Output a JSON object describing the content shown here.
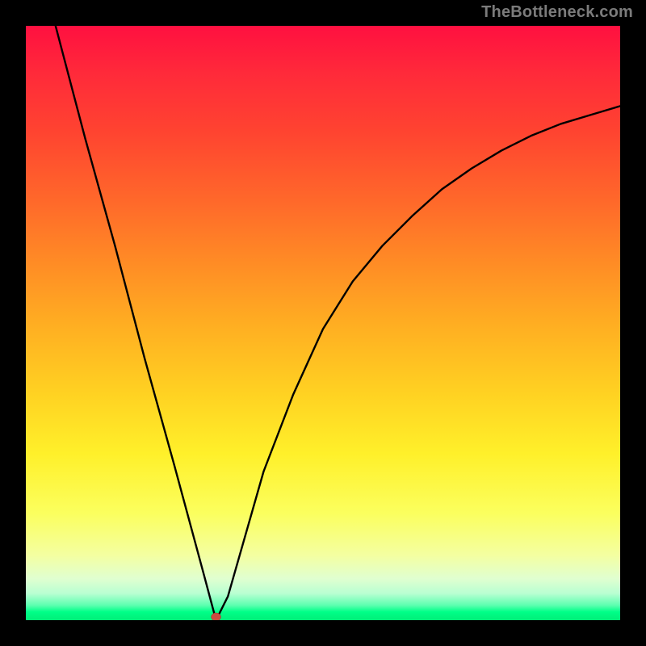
{
  "watermark": "TheBottleneck.com",
  "colors": {
    "background": "#000000",
    "curve": "#000000",
    "dot": "#cc4a3f",
    "gradient_top": "#ff1040",
    "gradient_mid": "#ffd222",
    "gradient_bottom": "#00ff88"
  },
  "chart_data": {
    "type": "line",
    "title": "",
    "xlabel": "",
    "ylabel": "",
    "xlim": [
      0,
      100
    ],
    "ylim": [
      0,
      100
    ],
    "grid": false,
    "legend": false,
    "annotations": [
      {
        "name": "minimum-marker",
        "x": 32,
        "y": 0
      }
    ],
    "series": [
      {
        "name": "left-branch",
        "x": [
          5,
          10,
          15,
          20,
          25,
          30,
          32
        ],
        "y": [
          100,
          81,
          63,
          44,
          26,
          7.5,
          0
        ]
      },
      {
        "name": "right-branch",
        "x": [
          32,
          34,
          36,
          38,
          40,
          45,
          50,
          55,
          60,
          65,
          70,
          75,
          80,
          85,
          90,
          95,
          100
        ],
        "y": [
          0,
          4,
          11,
          18,
          25,
          38,
          49,
          57,
          63,
          68,
          72.5,
          76,
          79,
          81.5,
          83.5,
          85,
          86.5
        ]
      }
    ]
  }
}
